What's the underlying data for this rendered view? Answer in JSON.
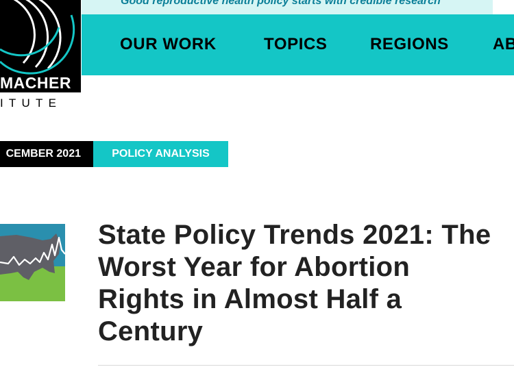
{
  "header": {
    "logo": {
      "name": "MACHER",
      "sub": "ITUTE"
    },
    "tagline": "Good reproductive health policy starts with credible research",
    "nav": [
      "OUR WORK",
      "TOPICS",
      "REGIONS",
      "AB"
    ]
  },
  "article": {
    "date": "CEMBER 2021",
    "type": "POLICY ANALYSIS",
    "title_lines": [
      "State Policy Trends 2021: The",
      "Worst Year for Abortion",
      "Rights in Almost Half a",
      "Century"
    ]
  },
  "colors": {
    "brand_teal": "#14c6c6",
    "tagline_bg": "#d6f5f4",
    "tagline_text": "#0b7f98",
    "thumb_sky": "#2a8fae",
    "thumb_ground": "#7bc043",
    "thumb_map": "#5f5f66"
  }
}
